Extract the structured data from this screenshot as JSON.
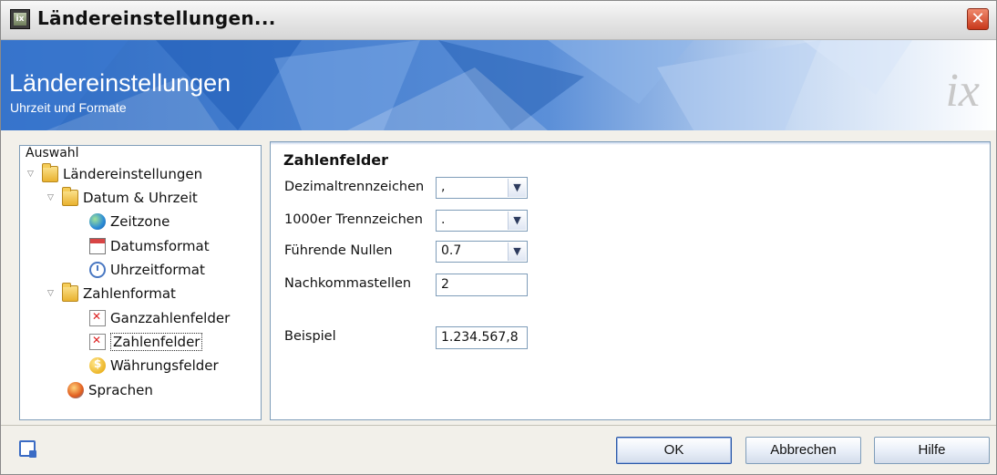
{
  "window": {
    "title": "Ländereinstellungen...",
    "app_icon": "ix-app-icon",
    "close_icon": "close-icon"
  },
  "banner": {
    "title": "Ländereinstellungen",
    "subtitle": "Uhrzeit und Formate",
    "logo_text": "ix"
  },
  "tree": {
    "header": "Auswahl",
    "items": [
      {
        "label": "Ländereinstellungen",
        "icon": "folder-icon",
        "expanded": true,
        "level": 0
      },
      {
        "label": "Datum & Uhrzeit",
        "icon": "folder-icon",
        "expanded": true,
        "level": 1
      },
      {
        "label": "Zeitzone",
        "icon": "globe-icon",
        "level": 2
      },
      {
        "label": "Datumsformat",
        "icon": "calendar-icon",
        "level": 2
      },
      {
        "label": "Uhrzeitformat",
        "icon": "clock-icon",
        "level": 2
      },
      {
        "label": "Zahlenformat",
        "icon": "folder-icon",
        "expanded": true,
        "level": 1
      },
      {
        "label": "Ganzzahlenfelder",
        "icon": "number-field-icon",
        "level": 2
      },
      {
        "label": "Zahlenfelder",
        "icon": "number-field-icon",
        "level": 2,
        "selected": true
      },
      {
        "label": "Währungsfelder",
        "icon": "currency-icon",
        "level": 2
      },
      {
        "label": "Sprachen",
        "icon": "language-icon",
        "level": 1
      }
    ]
  },
  "content": {
    "section_title": "Zahlenfelder",
    "fields": {
      "decimal_separator": {
        "label": "Dezimaltrennzeichen",
        "value": ","
      },
      "thousands_separator": {
        "label": "1000er Trennzeichen",
        "value": "."
      },
      "leading_zeros": {
        "label": "Führende Nullen",
        "value": "0.7"
      },
      "decimal_places": {
        "label": "Nachkommastellen",
        "value": "2"
      },
      "example": {
        "label": "Beispiel",
        "value": "1.234.567,8"
      }
    }
  },
  "footer": {
    "ok_label": "OK",
    "cancel_label": "Abbrechen",
    "help_label": "Hilfe"
  },
  "colors": {
    "banner_blue": "#2f6fc7",
    "selection_border": "#333333",
    "close_red": "#c8381b"
  }
}
